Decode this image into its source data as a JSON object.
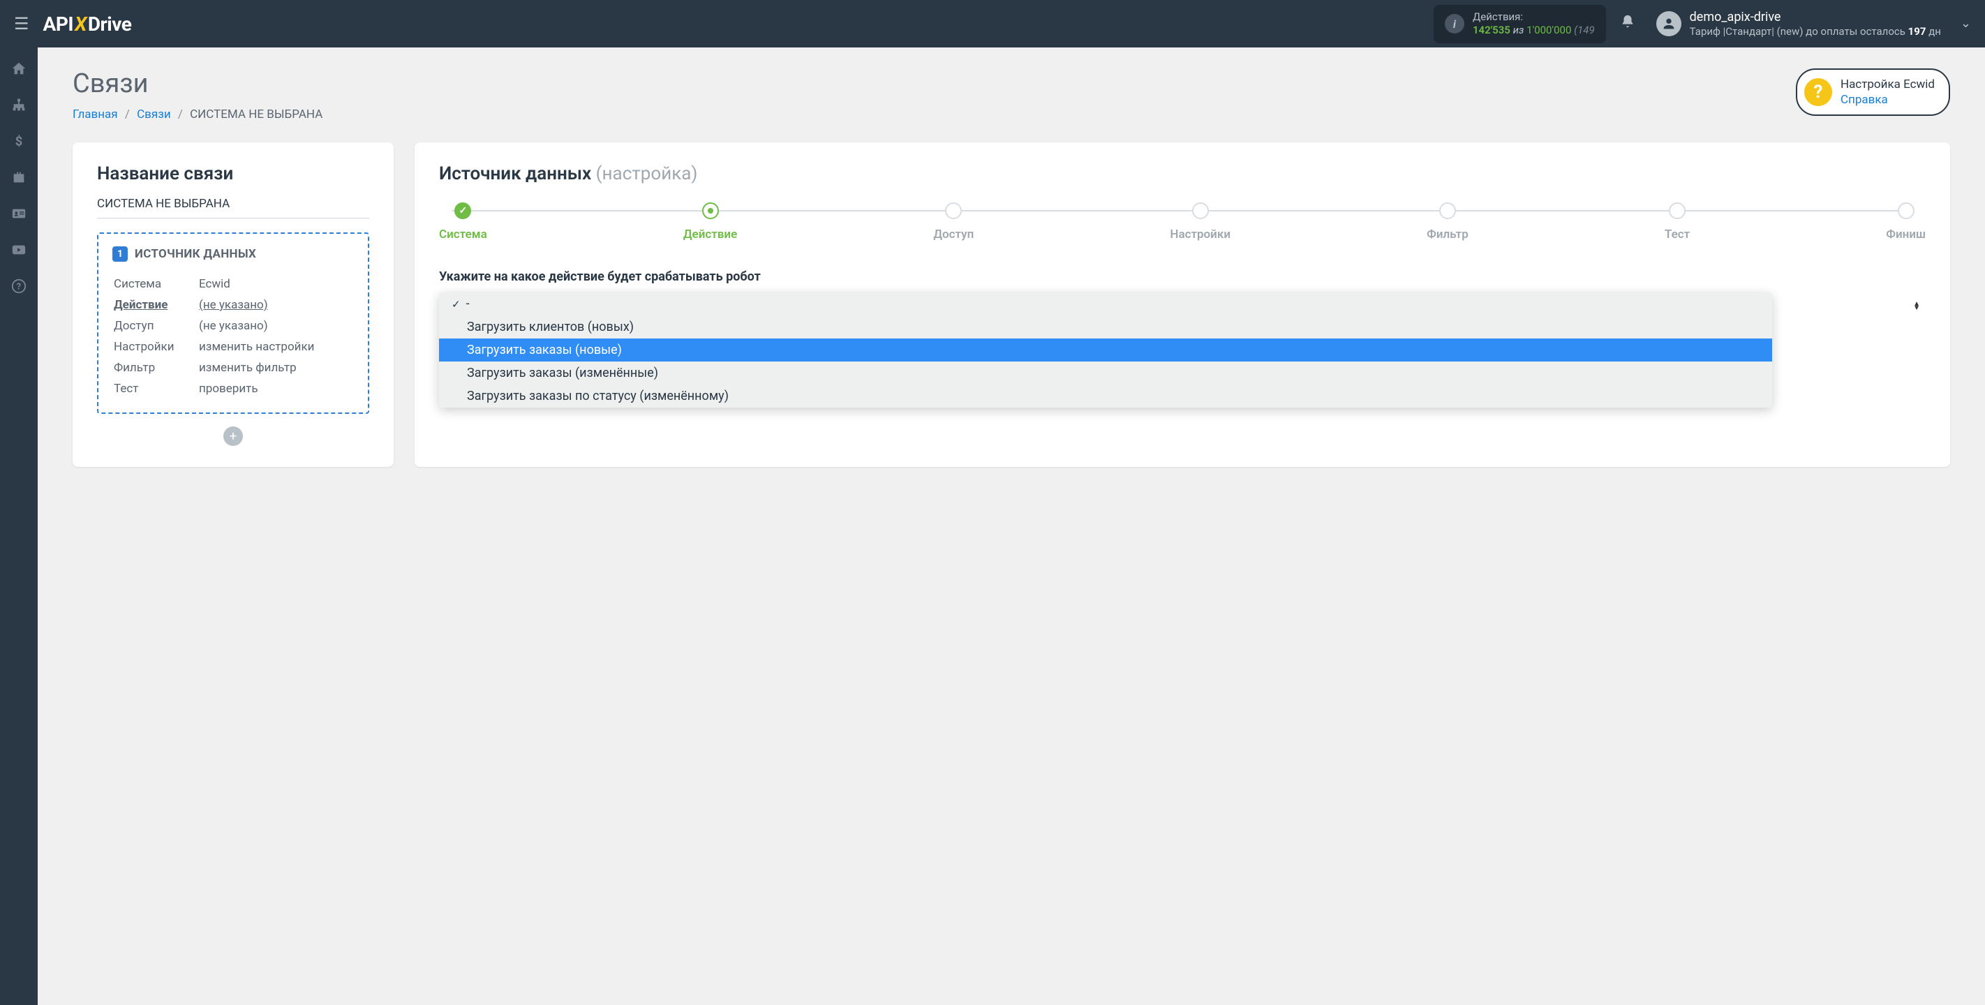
{
  "header": {
    "logo": {
      "api": "API",
      "x": "X",
      "drive": "Drive"
    },
    "actions_label": "Действия:",
    "actions_count": "142'535",
    "actions_of": "из",
    "actions_total": "1'000'000",
    "actions_paren": "(149",
    "user_name": "demo_apix-drive",
    "tariff_prefix": "Тариф |Стандарт| (new) до оплаты осталось ",
    "tariff_days": "197",
    "tariff_suffix": " дн"
  },
  "page": {
    "title": "Связи",
    "breadcrumb_home": "Главная",
    "breadcrumb_links": "Связи",
    "breadcrumb_current": "СИСТЕМА НЕ ВЫБРАНА"
  },
  "help": {
    "title": "Настройка Ecwid",
    "link": "Справка"
  },
  "left_card": {
    "title": "Название связи",
    "subtitle": "СИСТЕМА НЕ ВЫБРАНА",
    "box_number": "1",
    "box_title": "ИСТОЧНИК ДАННЫХ",
    "rows": [
      {
        "label": "Система",
        "value": "Ecwid",
        "link": true
      },
      {
        "label": "Действие",
        "value": "(не указано)",
        "link": true,
        "bold": true,
        "underline": true
      },
      {
        "label": "Доступ",
        "value": "(не указано)",
        "link": true
      },
      {
        "label": "Настройки",
        "value": "изменить настройки"
      },
      {
        "label": "Фильтр",
        "value": "изменить фильтр"
      },
      {
        "label": "Тест",
        "value": "проверить"
      }
    ]
  },
  "right_card": {
    "title": "Источник данных",
    "title_muted": "(настройка)",
    "steps": [
      {
        "label": "Система",
        "state": "done"
      },
      {
        "label": "Действие",
        "state": "active"
      },
      {
        "label": "Доступ",
        "state": ""
      },
      {
        "label": "Настройки",
        "state": ""
      },
      {
        "label": "Фильтр",
        "state": ""
      },
      {
        "label": "Тест",
        "state": ""
      },
      {
        "label": "Финиш",
        "state": ""
      }
    ],
    "field_label": "Укажите на какое действие будет срабатывать робот",
    "dropdown": [
      {
        "label": "-",
        "selected": true
      },
      {
        "label": "Загрузить клиентов (новых)"
      },
      {
        "label": "Загрузить заказы (новые)",
        "highlighted": true
      },
      {
        "label": "Загрузить заказы (изменённые)"
      },
      {
        "label": "Загрузить заказы по статусу (изменённому)"
      }
    ]
  }
}
